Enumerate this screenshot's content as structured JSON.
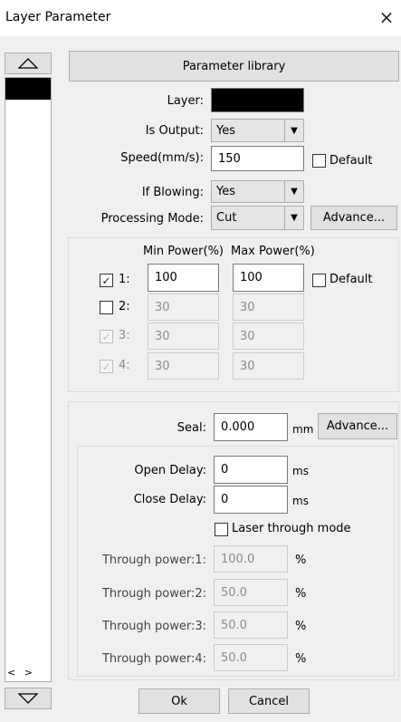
{
  "window": {
    "title": "Layer Parameter",
    "close_icon": "×"
  },
  "sidebar": {
    "up_icon": "triangle-up",
    "down_icon": "triangle-down",
    "scroll_arrows": "< >",
    "layer_swatch_color": "#000000"
  },
  "form": {
    "library_button": "Parameter library",
    "layer_label": "Layer:",
    "layer_color": "#000000",
    "is_output_label": "Is Output:",
    "is_output_value": "Yes",
    "speed_label": "Speed(mm/s):",
    "speed_value": "150",
    "default_label": "Default",
    "if_blowing_label": "If Blowing:",
    "if_blowing_value": "Yes",
    "processing_mode_label": "Processing Mode:",
    "processing_mode_value": "Cut",
    "advance_button": "Advance..."
  },
  "power": {
    "min_header": "Min Power(%)",
    "max_header": "Max Power(%)",
    "default_label": "Default",
    "rows": [
      {
        "label": "1:",
        "checked": true,
        "enabled": true,
        "min": "100",
        "max": "100"
      },
      {
        "label": "2:",
        "checked": false,
        "enabled": true,
        "min": "30",
        "max": "30"
      },
      {
        "label": "3:",
        "checked": true,
        "enabled": false,
        "min": "30",
        "max": "30"
      },
      {
        "label": "4:",
        "checked": true,
        "enabled": false,
        "min": "30",
        "max": "30"
      }
    ]
  },
  "seal": {
    "label": "Seal:",
    "value": "0.000",
    "unit": "mm",
    "advance_button": "Advance..."
  },
  "delay": {
    "open_label": "Open Delay:",
    "open_value": "0",
    "close_label": "Close Delay:",
    "close_value": "0",
    "unit": "ms",
    "laser_through_label": "Laser through mode",
    "through_rows": [
      {
        "label": "Through power:1:",
        "value": "100.0",
        "unit": "%"
      },
      {
        "label": "Through power:2:",
        "value": "50.0",
        "unit": "%"
      },
      {
        "label": "Through power:3:",
        "value": "50.0",
        "unit": "%"
      },
      {
        "label": "Through power:4:",
        "value": "50.0",
        "unit": "%"
      }
    ]
  },
  "footer": {
    "ok_button": "Ok",
    "cancel_button": "Cancel"
  }
}
